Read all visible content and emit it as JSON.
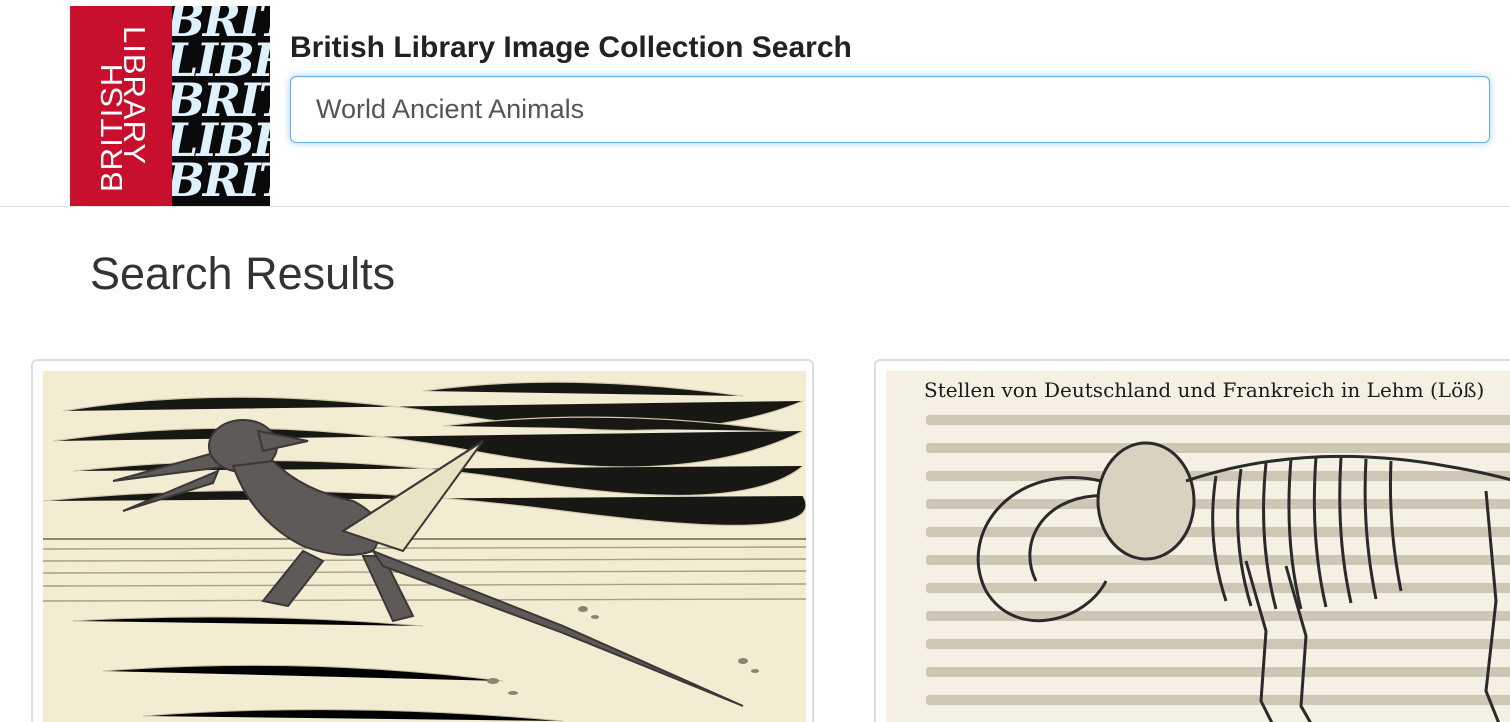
{
  "logo": {
    "red_word_1": "BRITISH",
    "red_word_2": "LIBRARY",
    "pattern_lines": [
      "BRITI",
      "LIBRA",
      "BRITI",
      "LIBRA",
      "BRITI"
    ]
  },
  "header": {
    "title": "British Library Image Collection Search"
  },
  "search": {
    "value": "World Ancient Animals"
  },
  "results": {
    "heading": "Search Results",
    "items": [
      {
        "subject": "pterodactyl engraving"
      },
      {
        "subject": "mammoth skeleton engraving",
        "caption_text": "Stellen von Deutschland und Frankreich in Lehm (Löß)"
      }
    ]
  },
  "colors": {
    "brand_red": "#c8102e",
    "focus_blue": "#66afe9",
    "paper": "#f1ecd2"
  }
}
